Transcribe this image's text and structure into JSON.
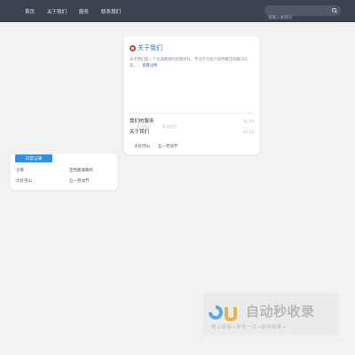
{
  "nav": {
    "items": [
      "首页",
      "关于我们",
      "服务",
      "联系我们"
    ],
    "search_placeholder": "请输入关键词"
  },
  "about": {
    "title": "关于我们",
    "desc": "关于我们是一个充满激情的创意团队，专注于为客户提供最佳的解决方案。",
    "more": "查看详情",
    "rows": [
      {
        "title": "我们的服务",
        "date": "11-29"
      },
      {
        "title": "关于我们",
        "date": "11-22"
      }
    ],
    "mini": [
      {
        "caption": "暂无图片",
        "name": "大好河山"
      },
      {
        "caption": "暂无图片",
        "name": "五一劳动节"
      }
    ]
  },
  "log": {
    "tab": "日常记录",
    "cells": [
      "仓库",
      "定档最满聊托",
      "大好河山",
      "五一劳动节"
    ]
  },
  "watermark": {
    "title": "自动秒收录",
    "sub": "做上链接→来访一次→自动收录→"
  },
  "colors": {
    "nav_bg": "#3d4250",
    "accent": "#2f8ee8",
    "brand_red": "#d33a2c"
  }
}
